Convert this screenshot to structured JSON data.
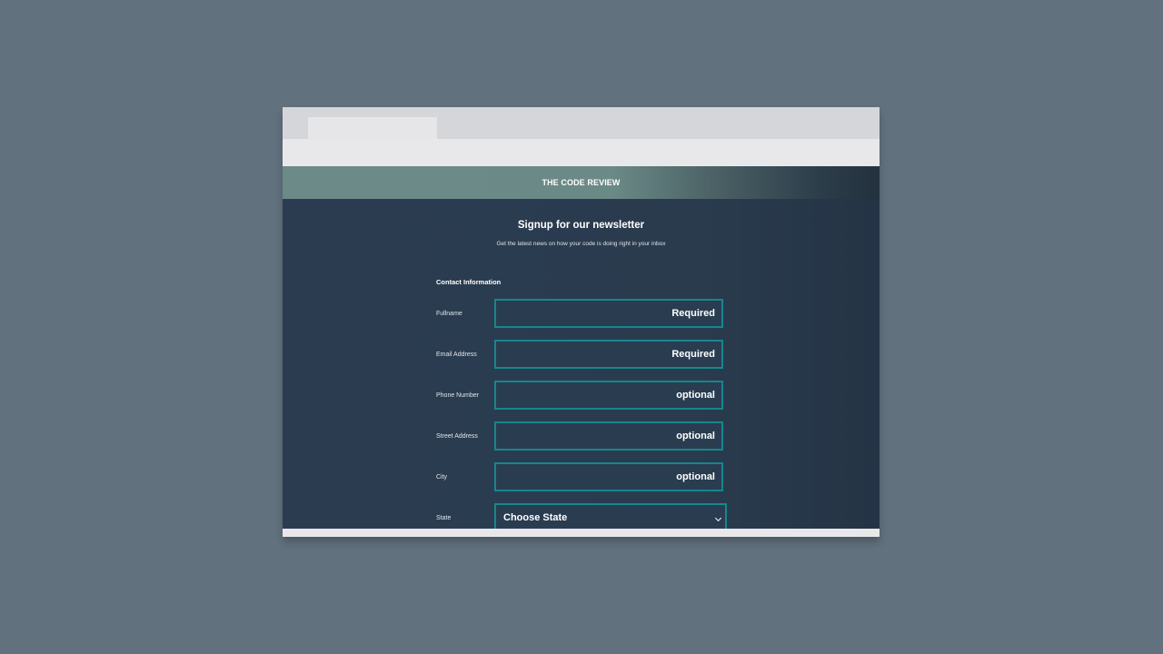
{
  "header": {
    "site_title": "THE CODE REVIEW"
  },
  "signup": {
    "title": "Signup for our newsletter",
    "subtitle": "Get the latest news on how your code is doing right in your inbox"
  },
  "form": {
    "section_title": "Contact Information",
    "fields": [
      {
        "label": "Fullname",
        "placeholder": "Required"
      },
      {
        "label": "Email Address",
        "placeholder": "Required"
      },
      {
        "label": "Phone Number",
        "placeholder": "optional"
      },
      {
        "label": "Street Address",
        "placeholder": "optional"
      },
      {
        "label": "City",
        "placeholder": "optional"
      }
    ],
    "state": {
      "label": "State",
      "selected": "Choose State"
    }
  },
  "colors": {
    "background": "#62717e",
    "page_bg": "#2b3c51",
    "header_teal": "#6b8a87",
    "input_border": "#16878c"
  },
  "icons": {
    "select_caret": "chevron-down-icon"
  }
}
